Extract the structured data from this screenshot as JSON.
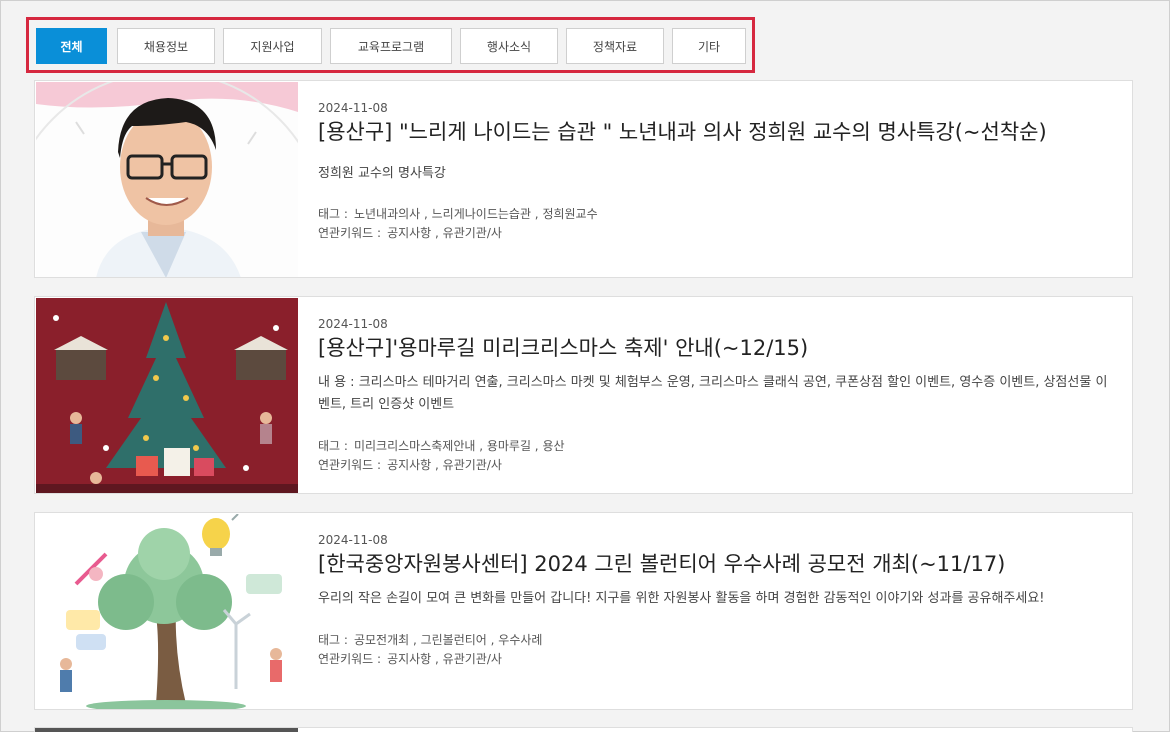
{
  "tabs": [
    {
      "label": "전체",
      "active": true
    },
    {
      "label": "채용정보",
      "active": false
    },
    {
      "label": "지원사업",
      "active": false
    },
    {
      "label": "교육프로그램",
      "active": false
    },
    {
      "label": "행사소식",
      "active": false
    },
    {
      "label": "정책자료",
      "active": false
    },
    {
      "label": "기타",
      "active": false
    }
  ],
  "colors": {
    "accent": "#0a8fd8",
    "highlight_box": "#d6283f"
  },
  "posts": [
    {
      "date": "2024-11-08",
      "title": "[용산구] \"느리게 나이드는 습관 \" 노년내과 의사 정희원 교수의 명사특강(~선착순)",
      "desc": "정희원 교수의 명사특강",
      "tag_label": "태그 :",
      "tags": "노년내과의사 , 느리게나이드는습관 , 정희원교수",
      "keyword_label": "연관키워드 :",
      "keywords": "공지사항 , 유관기관/사",
      "image": "professor-portrait"
    },
    {
      "date": "2024-11-08",
      "title": "[용산구]'용마루길 미리크리스마스 축제' 안내(~12/15)",
      "desc": "내 용 : 크리스마스 테마거리 연출, 크리스마스 마켓 및 체험부스 운영, 크리스마스 클래식 공연, 쿠폰상점 할인 이벤트, 영수증 이벤트, 상점선물 이벤트, 트리 인증샷 이벤트",
      "tag_label": "태그 :",
      "tags": "미리크리스마스축제안내 , 용마루길 , 용산",
      "keyword_label": "연관키워드 :",
      "keywords": "공지사항 , 유관기관/사",
      "image": "christmas-market-illustration"
    },
    {
      "date": "2024-11-08",
      "title": "[한국중앙자원봉사센터] 2024 그린 볼런티어 우수사례 공모전 개최(~11/17)",
      "desc": "우리의 작은 손길이 모여 큰 변화를 만들어 갑니다! 지구를 위한 자원봉사 활동을 하며 경험한 감동적인 이야기와 성과를 공유해주세요!",
      "tag_label": "태그 :",
      "tags": "공모전개최 , 그린볼런티어 , 우수사례",
      "keyword_label": "연관키워드 :",
      "keywords": "공지사항 , 유관기관/사",
      "image": "green-volunteer-tree-illustration"
    }
  ]
}
